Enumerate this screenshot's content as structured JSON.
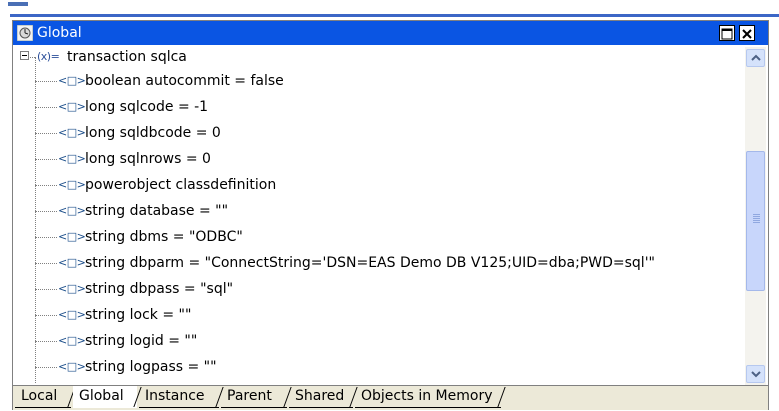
{
  "window": {
    "title": "Global"
  },
  "tree": {
    "root": {
      "icon": "(x)=",
      "label": "transaction sqlca"
    },
    "items": [
      {
        "icon": "<□>",
        "label": "boolean autocommit =  false"
      },
      {
        "icon": "<□>",
        "label": "long sqlcode =  -1"
      },
      {
        "icon": "<□>",
        "label": "long sqldbcode =  0"
      },
      {
        "icon": "<□>",
        "label": "long sqlnrows =  0"
      },
      {
        "icon": "<□>",
        "label": "powerobject classdefinition"
      },
      {
        "icon": "<□>",
        "label": "string database =  \"\""
      },
      {
        "icon": "<□>",
        "label": "string dbms =  \"ODBC\""
      },
      {
        "icon": "<□>",
        "label": "string dbparm =  \"ConnectString='DSN=EAS Demo DB V125;UID=dba;PWD=sql'\""
      },
      {
        "icon": "<□>",
        "label": "string dbpass =  \"sql\""
      },
      {
        "icon": "<□>",
        "label": "string lock =  \"\""
      },
      {
        "icon": "<□>",
        "label": "string logid =  \"\""
      },
      {
        "icon": "<□>",
        "label": "string logpass =  \"\""
      }
    ]
  },
  "tabs": [
    {
      "label": "Local"
    },
    {
      "label": "Global"
    },
    {
      "label": "Instance"
    },
    {
      "label": "Parent"
    },
    {
      "label": "Shared"
    },
    {
      "label": "Objects in Memory"
    }
  ],
  "colors": {
    "titlebar": "#0a55e3",
    "title_text": "#ffffff",
    "tab_bar": "#ece9d8"
  },
  "icons": {
    "window": "watch-icon",
    "expander": "minus-box-icon",
    "variable": "variable-icon",
    "scroll_up": "chevron-up-icon",
    "scroll_down": "chevron-down-icon"
  }
}
